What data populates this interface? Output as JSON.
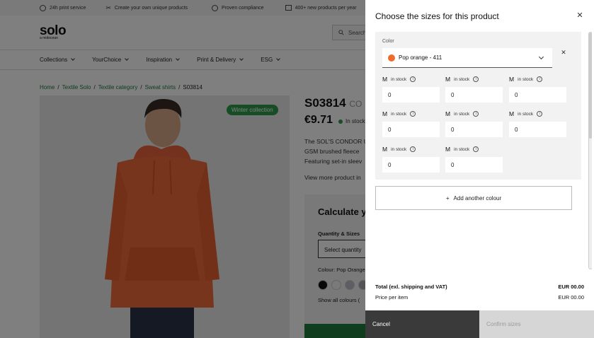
{
  "topbar": {
    "items": [
      {
        "icon": "clock-icon",
        "label": "24h print service"
      },
      {
        "icon": "scissors-icon",
        "label": "Create your own unique products"
      },
      {
        "icon": "check-circle-icon",
        "label": "Proven compliance"
      },
      {
        "icon": "package-icon",
        "label": "400+ new products per year"
      }
    ]
  },
  "header": {
    "logo_main": "solo",
    "logo_sub": "a midocean",
    "search_placeholder": "Search"
  },
  "nav": {
    "items": [
      {
        "label": "Collections"
      },
      {
        "label": "YourChoice"
      },
      {
        "label": "Inspiration"
      },
      {
        "label": "Print & Delivery"
      },
      {
        "label": "ESG"
      }
    ]
  },
  "breadcrumb": {
    "items": [
      "Home",
      "Textile Solo",
      "Textile category",
      "Sweat shirts"
    ],
    "current": "S03814",
    "separator": "/"
  },
  "product": {
    "badge": "Winter collection",
    "code": "S03814",
    "code_suffix": "CO",
    "price": "€9.71",
    "stock": "In stock",
    "desc_lines": [
      "The SOL'S CONDOR U",
      "GSM brushed fleece",
      "Featuring set-in sleev"
    ],
    "view_more": "View more product in",
    "calc_title": "Calculate y",
    "qty_label": "Quantity & Sizes",
    "qty_select": "Select quantity",
    "colour_label": "Colour: Pop Orange",
    "show_all": "Show all colours (",
    "swatch_colors": [
      "#111111",
      "#f4f4f4",
      "#b8bcc6",
      "#a4a8b0"
    ]
  },
  "drawer": {
    "title": "Choose the sizes for this product",
    "color_field_label": "Color",
    "color_value": "Pop orange - 411",
    "color_swatch": "#ee6b2b",
    "sizes": [
      {
        "size": "M",
        "status": "in stock",
        "value": "0"
      },
      {
        "size": "M",
        "status": "in stock",
        "value": "0"
      },
      {
        "size": "M",
        "status": "in stock",
        "value": "0"
      },
      {
        "size": "M",
        "status": "in stock",
        "value": "0"
      },
      {
        "size": "M",
        "status": "in stock",
        "value": "0"
      },
      {
        "size": "M",
        "status": "in stock",
        "value": "0"
      },
      {
        "size": "M",
        "status": "in stock",
        "value": "0"
      },
      {
        "size": "M",
        "status": "in stock",
        "value": "0"
      }
    ],
    "add_colour": "Add another colour",
    "total_label": "Total (exl. shipping and VAT)",
    "total_value": "EUR 00.00",
    "ppi_label": "Price per item",
    "ppi_value": "EUR 00.00",
    "cancel": "Cancel",
    "confirm": "Confirm sizes"
  }
}
